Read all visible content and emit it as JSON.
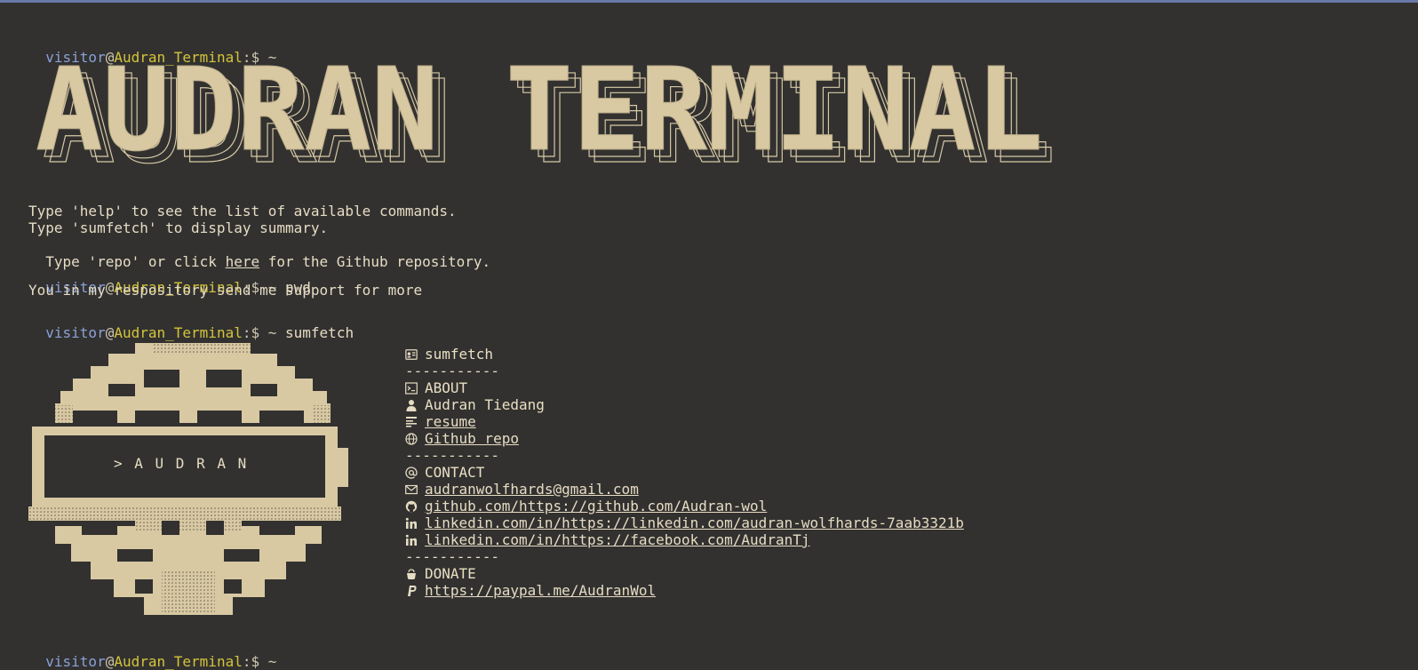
{
  "prompt": {
    "user": "visitor",
    "at": "@",
    "host": "Audran_Terminal",
    "symbol": ":$ ~"
  },
  "banner": {
    "title": "AUDRAN TERMINAL"
  },
  "welcome": {
    "line1": "Type 'help' to see the list of available commands.",
    "line2": "Type 'sumfetch' to display summary.",
    "line3_pre": "Type 'repo' or click ",
    "line3_link": "here",
    "line3_post": " for the Github repository."
  },
  "history": [
    {
      "command": "pwd",
      "output": "You in my respository send me support for more"
    },
    {
      "command": "sumfetch"
    }
  ],
  "logo": {
    "label": "> A U D R A N"
  },
  "sumfetch": {
    "header": "sumfetch",
    "separator": "-----------",
    "about_title": "ABOUT",
    "name": "Audran Tiedang",
    "resume": "resume",
    "github_repo": "Github repo",
    "contact_title": "CONTACT",
    "email": "audranwolfhards@gmail.com",
    "github": "github.com/https://github.com/Audran-wol",
    "linkedin": "linkedin.com/in/https://linkedin.com/audran-wolfhards-7aab3321b",
    "facebook": "linkedin.com/in/https://facebook.com/AudranTj",
    "donate_title": "DONATE",
    "paypal": "https://paypal.me/AudranWol"
  },
  "icons": {
    "id-card": "id-card-icon",
    "terminal": "terminal-icon",
    "user": "user-icon",
    "resume": "resume-icon",
    "globe": "globe-icon",
    "at": "at-icon",
    "mail": "mail-icon",
    "github": "github-icon",
    "linkedin": "linkedin-icon",
    "donate": "donate-icon",
    "paypal": "paypal-icon"
  },
  "colors": {
    "background": "#323130",
    "text": "#e6dcc3",
    "user": "#8aa1d6",
    "host": "#d4c43a"
  }
}
